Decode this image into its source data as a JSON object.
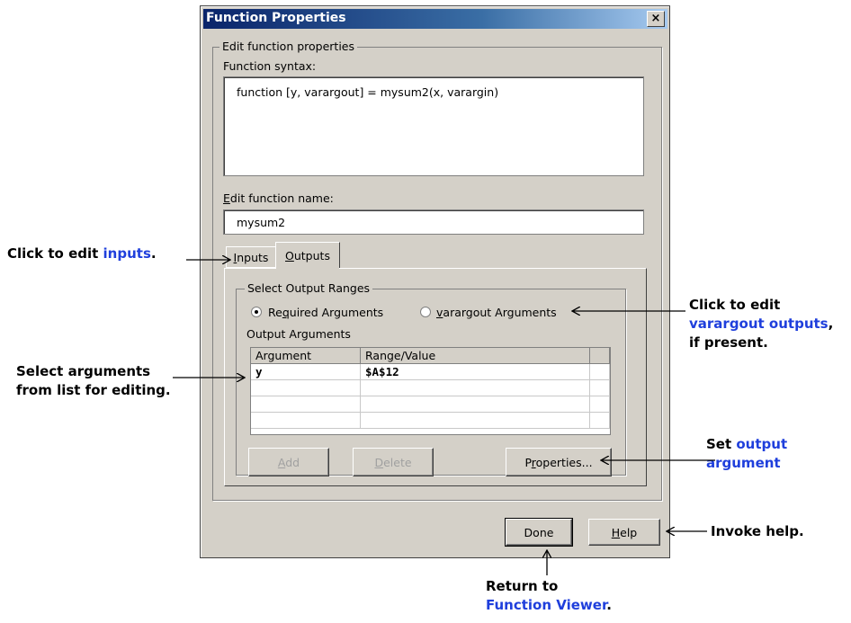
{
  "dialog": {
    "title": "Function Properties",
    "close_label": "×",
    "group_edit": "Edit function properties",
    "syntax_label": "Function syntax:",
    "syntax_value": "function [y, varargout] = mysum2(x, varargin)",
    "name_label": "Edit function name:",
    "name_value": "mysum2",
    "tabs": [
      {
        "label": "Inputs"
      },
      {
        "label": "Outputs"
      }
    ],
    "group_output": "Select Output Ranges",
    "radio_required": "Required Arguments",
    "radio_varargout": "varargout Arguments",
    "output_args_label": "Output Arguments",
    "columns": [
      "Argument",
      "Range/Value"
    ],
    "rows": [
      [
        "y",
        "$A$12"
      ],
      [
        "",
        ""
      ],
      [
        "",
        ""
      ],
      [
        "",
        ""
      ]
    ],
    "add_button": "Add",
    "delete_button": "Delete",
    "properties_button": "Properties...",
    "done_button": "Done",
    "help_button": "Help"
  },
  "annotations": {
    "inputs": {
      "prefix": "Click to edit ",
      "highlight": "inputs",
      "suffix": "."
    },
    "varargout": {
      "line1": "Click to edit",
      "line2": "varargout outputs",
      "line2_suffix": ",",
      "line3": "if present."
    },
    "select_args": {
      "line1": "Select arguments",
      "line2": "from list for editing."
    },
    "set_output": {
      "prefix": "Set ",
      "hl1": "output",
      "line2": "argument"
    },
    "invoke_help": "Invoke help.",
    "return": {
      "line1": "Return to",
      "line2": "Function Viewer",
      "suffix": "."
    }
  },
  "colors": {
    "highlight": "#1f3fdc",
    "titlebar": "#0a246a",
    "face": "#d4d0c8"
  }
}
